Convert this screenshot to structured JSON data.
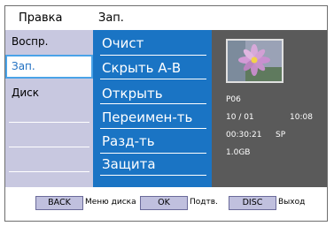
{
  "header": {
    "left_label": "Правка",
    "right_label": "Зап."
  },
  "tabs": [
    {
      "label": "Воспр."
    },
    {
      "label": "Зап."
    },
    {
      "label": "Диск"
    }
  ],
  "selected_tab": "Зап.",
  "menu": {
    "items": [
      "Очист",
      "Скрыть А-В",
      "Открыть",
      "Переимен-ть",
      "Разд-ть",
      "Защита"
    ]
  },
  "info": {
    "title_id": "P06",
    "date": "10 / 01",
    "time": "10:08",
    "duration": "00:30:21",
    "mode": "SP",
    "size": "1.0GB"
  },
  "footer": {
    "back_button": "BACK",
    "back_text": "Меню диска",
    "ok_button": "OK",
    "ok_text": "Подтв.",
    "disc_button": "DISC",
    "disc_text": "Выход"
  },
  "colors": {
    "menu_bg": "#1a74c4",
    "info_bg": "#5a5a5a",
    "tabs_bg": "#c8c8e0",
    "selected_border": "#4aa3e8"
  }
}
